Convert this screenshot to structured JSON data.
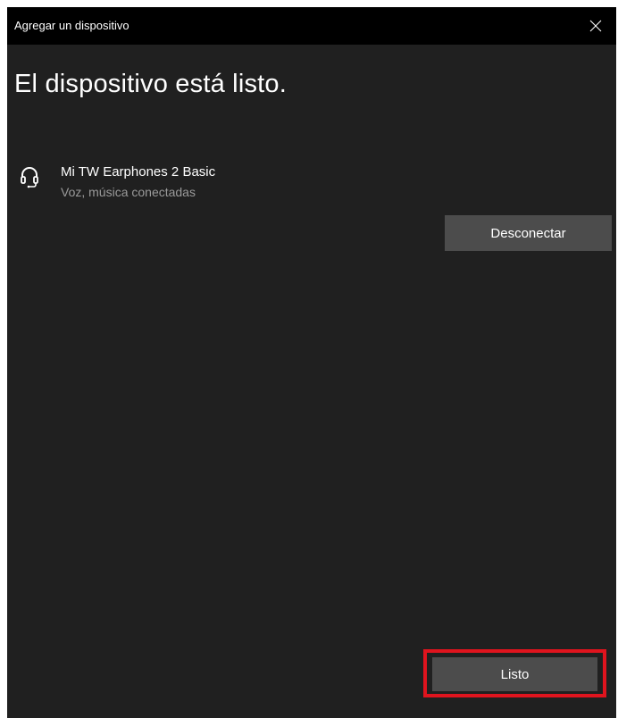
{
  "window": {
    "title": "Agregar un dispositivo",
    "close_icon": "close-icon"
  },
  "main": {
    "heading": "El dispositivo está listo."
  },
  "device": {
    "icon": "headset-icon",
    "name": "Mi TW Earphones 2 Basic",
    "status": "Voz, música conectadas"
  },
  "actions": {
    "disconnect_label": "Desconectar",
    "done_label": "Listo"
  },
  "colors": {
    "window_bg": "#202020",
    "titlebar_bg": "#000000",
    "button_bg": "#4c4c4c",
    "secondary_text": "#9a9a9a",
    "highlight": "#e0141e"
  }
}
